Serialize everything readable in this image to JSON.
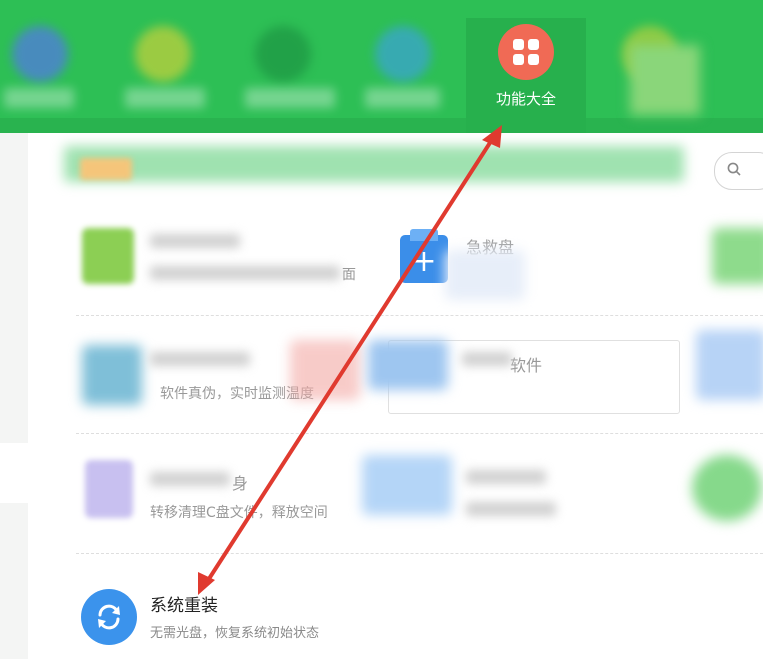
{
  "nav": {
    "active_label": "功能大全",
    "active_icon": "grid-icon",
    "colors": {
      "bar": "#2dbf55",
      "active_icon_bg": "#f06a55"
    }
  },
  "list": {
    "item_plus_title_fragment": "急救盘",
    "item_row2_desc_fragment": "软件真伪，实时监测温度",
    "item_row2_right_fragment": "软件",
    "item_row3_title_fragment": "身",
    "item_row3_desc": "转移清理C盘文件，释放空间",
    "item_row1_desc_fragment": "面"
  },
  "reinstall": {
    "title": "系统重装",
    "description": "无需光盘，恢复系统初始状态",
    "icon": "refresh-icon",
    "icon_color": "#3b93ec"
  },
  "annotation": {
    "color": "#e03a2f"
  }
}
